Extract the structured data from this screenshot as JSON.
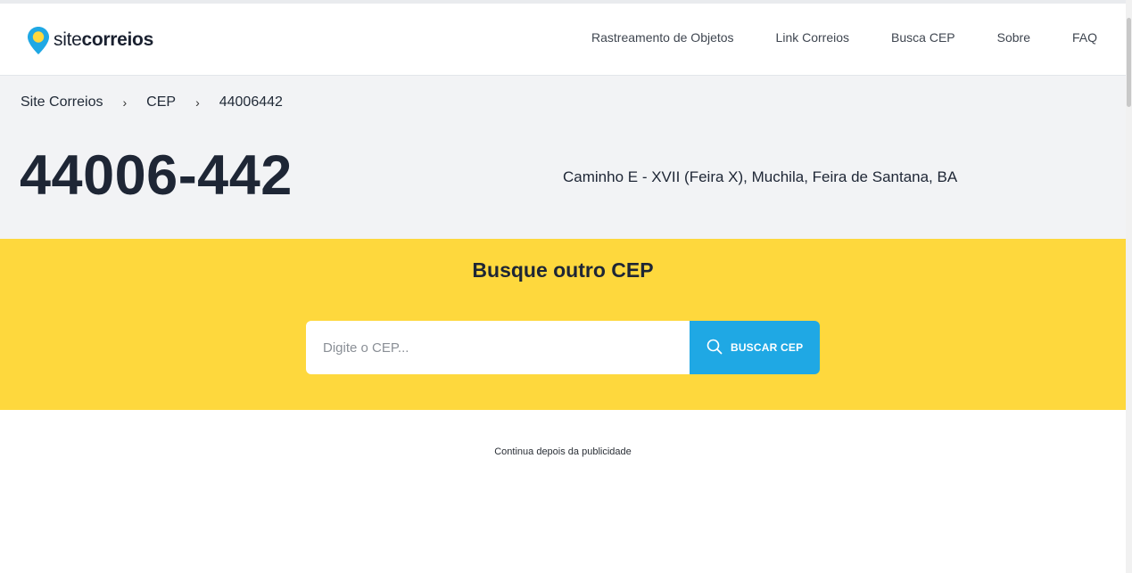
{
  "header": {
    "logo": {
      "light": "site",
      "bold": "correios"
    },
    "nav": [
      {
        "label": "Rastreamento de Objetos"
      },
      {
        "label": "Link Correios"
      },
      {
        "label": "Busca CEP"
      },
      {
        "label": "Sobre"
      },
      {
        "label": "FAQ"
      }
    ]
  },
  "breadcrumb": {
    "items": [
      "Site Correios",
      "CEP",
      "44006442"
    ],
    "separator": "›"
  },
  "cep": {
    "formatted": "44006-442",
    "address": "Caminho E - XVII (Feira X), Muchila, Feira de Santana, BA"
  },
  "search": {
    "title": "Busque outro CEP",
    "placeholder": "Digite o CEP...",
    "value": "",
    "button_label": "BUSCAR CEP"
  },
  "ad": {
    "note": "Continua depois da publicidade"
  },
  "colors": {
    "brand_yellow": "#fed83d",
    "brand_blue": "#1fa8e4",
    "hero_gray": "#f2f3f5",
    "text_dark": "#1e2635"
  },
  "icons": {
    "logo": "map-pin-icon",
    "search": "search-icon"
  }
}
